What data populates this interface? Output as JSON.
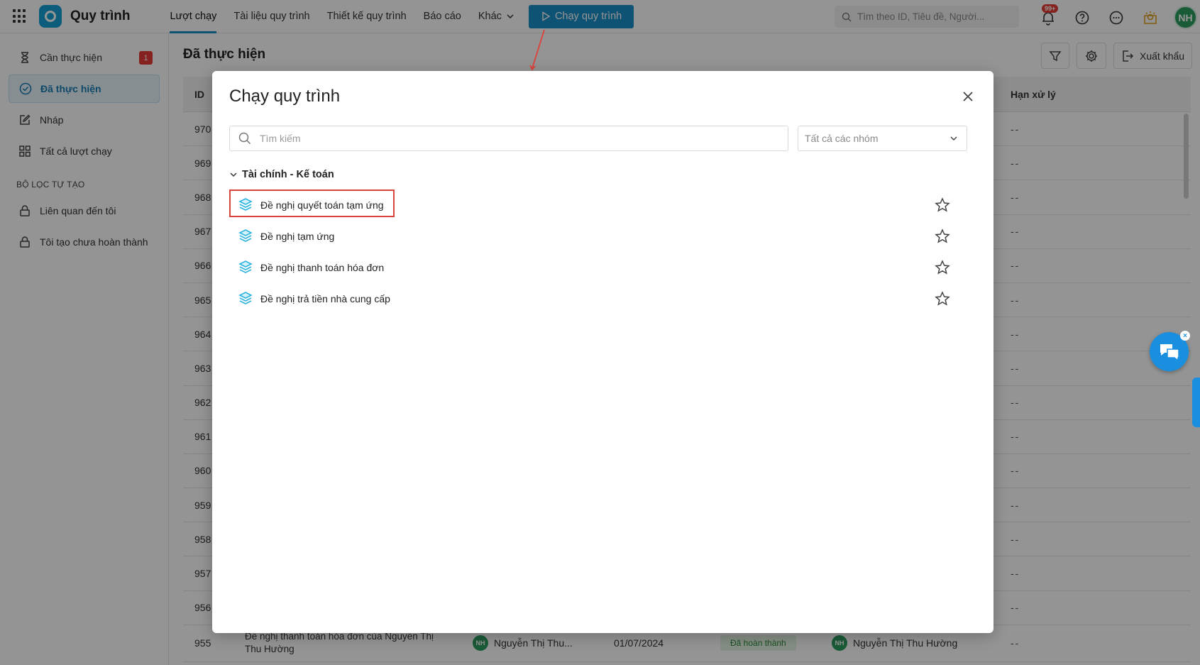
{
  "topbar": {
    "app_title": "Quy trình",
    "nav": [
      "Lượt chạy",
      "Tài liệu quy trình",
      "Thiết kế quy trình",
      "Báo cáo"
    ],
    "nav_more": "Khác",
    "run_button": "Chạy quy trình",
    "search_placeholder": "Tìm theo ID, Tiêu đề, Người...",
    "notif_count": "99+",
    "user_initials": "NH"
  },
  "sidebar": {
    "items": [
      {
        "label": "Cần thực hiện",
        "badge": "1"
      },
      {
        "label": "Đã thực hiện"
      },
      {
        "label": "Nháp"
      },
      {
        "label": "Tất cả lượt chạy"
      }
    ],
    "section_title": "BỘ LỌC TỰ TẠO",
    "custom_filters": [
      {
        "label": "Liên quan đến tôi"
      },
      {
        "label": "Tôi tạo chưa hoàn thành"
      }
    ]
  },
  "main": {
    "title": "Đã thực hiện",
    "export_label": "Xuất khẩu",
    "columns": {
      "id": "ID",
      "deadline": "Hạn xử lý"
    },
    "row_ids": [
      "970",
      "969",
      "968",
      "967",
      "966",
      "965",
      "964",
      "963",
      "962",
      "961",
      "960",
      "959",
      "958",
      "957",
      "956"
    ],
    "empty_deadline": "--",
    "last_row": {
      "id": "955",
      "name": "Đề nghị thanh toán hóa đơn của Nguyễn Thị Thu Hường",
      "initiator_initials": "NH",
      "initiator": "Nguyễn Thị Thu...",
      "date": "01/07/2024",
      "status": "Đã hoàn thành",
      "assignee_initials": "NH",
      "assignee": "Nguyễn Thị Thu Hường",
      "deadline": "--"
    }
  },
  "modal": {
    "title": "Chạy quy trình",
    "search_placeholder": "Tìm kiếm",
    "group_select": "Tất cả các nhóm",
    "group_name": "Tài chính - Kế toán",
    "processes": [
      {
        "label": "Đề nghị quyết toán tạm ứng"
      },
      {
        "label": "Đề nghị tạm ứng"
      },
      {
        "label": "Đề nghị thanh toán hóa đơn"
      },
      {
        "label": "Đề nghị trả tiền nhà cung cấp"
      }
    ]
  },
  "colors": {
    "accent": "#1b8fc8",
    "badge": "#e53935",
    "highlight": "#d9453b",
    "process_icon": "#2bb3dd",
    "avatar": "#2e9e5f",
    "status_bg": "#e4f5e4"
  }
}
